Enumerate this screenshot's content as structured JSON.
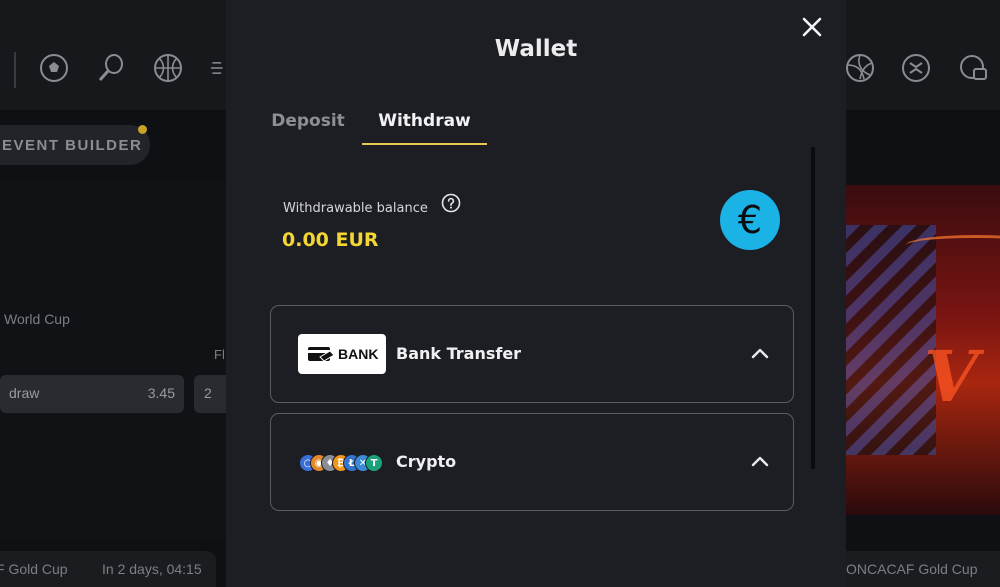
{
  "background": {
    "event_builder": "EVENT BUILDER",
    "competition": "World Cup",
    "fl_text": "Fl",
    "odds": {
      "label": "draw",
      "value": "3.45",
      "next": "2"
    },
    "bottom_left": {
      "competition": "F Gold Cup",
      "time": "In 2 days, 04:15"
    },
    "bottom_right": "ONCACAF Gold Cup",
    "sport_icons": [
      "soccer-ball-icon",
      "tennis-icon",
      "basketball-icon",
      "volleyball-icon",
      "fantasy-icon",
      "esports-icon"
    ]
  },
  "modal": {
    "title": "Wallet",
    "close_icon": "close-icon",
    "tabs": [
      {
        "label": "Deposit",
        "active": false
      },
      {
        "label": "Withdraw",
        "active": true
      }
    ],
    "balance": {
      "label": "Withdrawable balance",
      "value": "0.00 EUR",
      "currency_symbol": "€",
      "help_icon": "question-circle-icon"
    },
    "methods": [
      {
        "name": "Bank Transfer",
        "logo_text": "BANK",
        "expanded_icon": "chevron-up-icon"
      },
      {
        "name": "Crypto",
        "logo": "crypto-coins-icon",
        "expanded_icon": "chevron-up-icon"
      }
    ]
  },
  "colors": {
    "accent_yellow": "#f3d634",
    "tab_underline": "#e9c94b",
    "currency_badge": "#1bb2e6",
    "modal_bg": "#1d1e23"
  }
}
